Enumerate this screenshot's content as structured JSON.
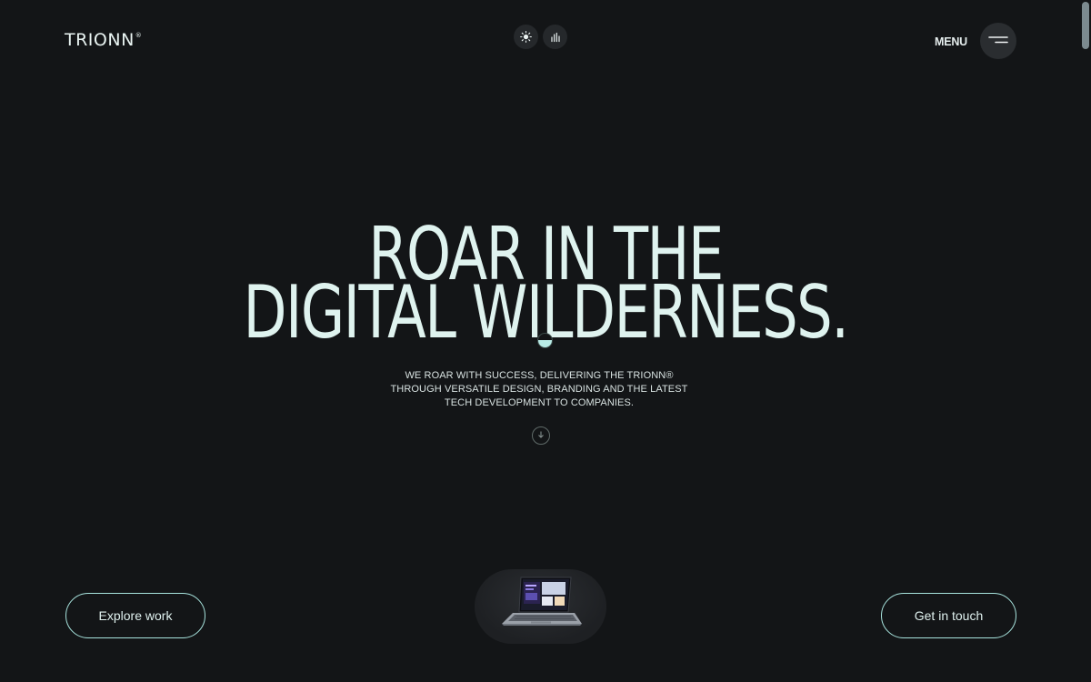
{
  "header": {
    "logo_text": "TRIONN",
    "logo_mark": "®",
    "theme_toggle_icon": "sun-icon",
    "sound_toggle_icon": "equalizer-icon",
    "menu_label": "MENU",
    "menu_icon": "hamburger-icon"
  },
  "hero": {
    "headline_line1": "ROAR IN THE",
    "headline_line2": "DIGITAL WILDERNESS.",
    "subtext_line1": "WE ROAR WITH SUCCESS, DELIVERING THE TRIONN®",
    "subtext_line2": "THROUGH VERSATILE DESIGN, BRANDING AND THE LATEST",
    "subtext_line3": "TECH DEVELOPMENT TO COMPANIES.",
    "scroll_icon": "arrow-down-icon"
  },
  "footer_actions": {
    "explore_label": "Explore work",
    "touch_label": "Get in touch",
    "showcase_icon": "laptop-icon"
  },
  "colors": {
    "background": "#131517",
    "accent": "#a7e3dd",
    "headline": "#dff3ef"
  }
}
